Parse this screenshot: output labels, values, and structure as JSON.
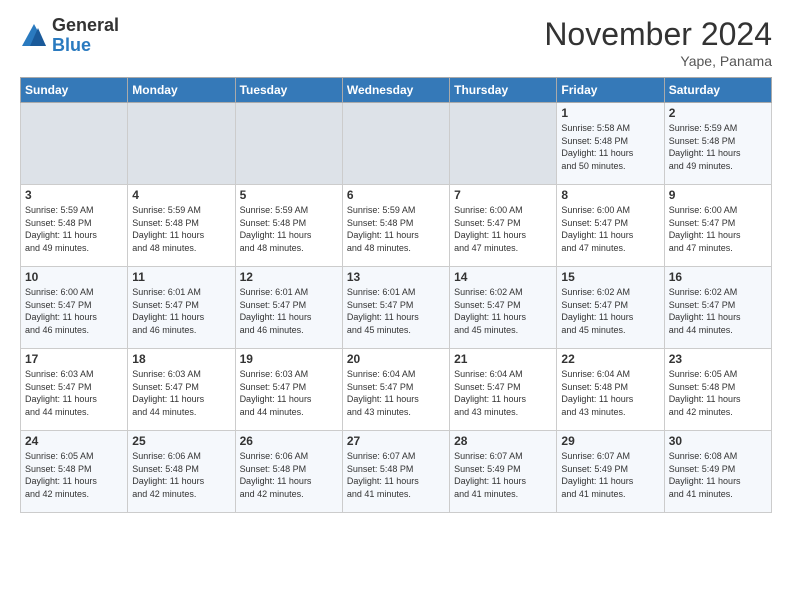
{
  "logo": {
    "general": "General",
    "blue": "Blue"
  },
  "header": {
    "month": "November 2024",
    "location": "Yape, Panama"
  },
  "days_of_week": [
    "Sunday",
    "Monday",
    "Tuesday",
    "Wednesday",
    "Thursday",
    "Friday",
    "Saturday"
  ],
  "weeks": [
    [
      {
        "day": "",
        "info": ""
      },
      {
        "day": "",
        "info": ""
      },
      {
        "day": "",
        "info": ""
      },
      {
        "day": "",
        "info": ""
      },
      {
        "day": "",
        "info": ""
      },
      {
        "day": "1",
        "info": "Sunrise: 5:58 AM\nSunset: 5:48 PM\nDaylight: 11 hours\nand 50 minutes."
      },
      {
        "day": "2",
        "info": "Sunrise: 5:59 AM\nSunset: 5:48 PM\nDaylight: 11 hours\nand 49 minutes."
      }
    ],
    [
      {
        "day": "3",
        "info": "Sunrise: 5:59 AM\nSunset: 5:48 PM\nDaylight: 11 hours\nand 49 minutes."
      },
      {
        "day": "4",
        "info": "Sunrise: 5:59 AM\nSunset: 5:48 PM\nDaylight: 11 hours\nand 48 minutes."
      },
      {
        "day": "5",
        "info": "Sunrise: 5:59 AM\nSunset: 5:48 PM\nDaylight: 11 hours\nand 48 minutes."
      },
      {
        "day": "6",
        "info": "Sunrise: 5:59 AM\nSunset: 5:48 PM\nDaylight: 11 hours\nand 48 minutes."
      },
      {
        "day": "7",
        "info": "Sunrise: 6:00 AM\nSunset: 5:47 PM\nDaylight: 11 hours\nand 47 minutes."
      },
      {
        "day": "8",
        "info": "Sunrise: 6:00 AM\nSunset: 5:47 PM\nDaylight: 11 hours\nand 47 minutes."
      },
      {
        "day": "9",
        "info": "Sunrise: 6:00 AM\nSunset: 5:47 PM\nDaylight: 11 hours\nand 47 minutes."
      }
    ],
    [
      {
        "day": "10",
        "info": "Sunrise: 6:00 AM\nSunset: 5:47 PM\nDaylight: 11 hours\nand 46 minutes."
      },
      {
        "day": "11",
        "info": "Sunrise: 6:01 AM\nSunset: 5:47 PM\nDaylight: 11 hours\nand 46 minutes."
      },
      {
        "day": "12",
        "info": "Sunrise: 6:01 AM\nSunset: 5:47 PM\nDaylight: 11 hours\nand 46 minutes."
      },
      {
        "day": "13",
        "info": "Sunrise: 6:01 AM\nSunset: 5:47 PM\nDaylight: 11 hours\nand 45 minutes."
      },
      {
        "day": "14",
        "info": "Sunrise: 6:02 AM\nSunset: 5:47 PM\nDaylight: 11 hours\nand 45 minutes."
      },
      {
        "day": "15",
        "info": "Sunrise: 6:02 AM\nSunset: 5:47 PM\nDaylight: 11 hours\nand 45 minutes."
      },
      {
        "day": "16",
        "info": "Sunrise: 6:02 AM\nSunset: 5:47 PM\nDaylight: 11 hours\nand 44 minutes."
      }
    ],
    [
      {
        "day": "17",
        "info": "Sunrise: 6:03 AM\nSunset: 5:47 PM\nDaylight: 11 hours\nand 44 minutes."
      },
      {
        "day": "18",
        "info": "Sunrise: 6:03 AM\nSunset: 5:47 PM\nDaylight: 11 hours\nand 44 minutes."
      },
      {
        "day": "19",
        "info": "Sunrise: 6:03 AM\nSunset: 5:47 PM\nDaylight: 11 hours\nand 44 minutes."
      },
      {
        "day": "20",
        "info": "Sunrise: 6:04 AM\nSunset: 5:47 PM\nDaylight: 11 hours\nand 43 minutes."
      },
      {
        "day": "21",
        "info": "Sunrise: 6:04 AM\nSunset: 5:47 PM\nDaylight: 11 hours\nand 43 minutes."
      },
      {
        "day": "22",
        "info": "Sunrise: 6:04 AM\nSunset: 5:48 PM\nDaylight: 11 hours\nand 43 minutes."
      },
      {
        "day": "23",
        "info": "Sunrise: 6:05 AM\nSunset: 5:48 PM\nDaylight: 11 hours\nand 42 minutes."
      }
    ],
    [
      {
        "day": "24",
        "info": "Sunrise: 6:05 AM\nSunset: 5:48 PM\nDaylight: 11 hours\nand 42 minutes."
      },
      {
        "day": "25",
        "info": "Sunrise: 6:06 AM\nSunset: 5:48 PM\nDaylight: 11 hours\nand 42 minutes."
      },
      {
        "day": "26",
        "info": "Sunrise: 6:06 AM\nSunset: 5:48 PM\nDaylight: 11 hours\nand 42 minutes."
      },
      {
        "day": "27",
        "info": "Sunrise: 6:07 AM\nSunset: 5:48 PM\nDaylight: 11 hours\nand 41 minutes."
      },
      {
        "day": "28",
        "info": "Sunrise: 6:07 AM\nSunset: 5:49 PM\nDaylight: 11 hours\nand 41 minutes."
      },
      {
        "day": "29",
        "info": "Sunrise: 6:07 AM\nSunset: 5:49 PM\nDaylight: 11 hours\nand 41 minutes."
      },
      {
        "day": "30",
        "info": "Sunrise: 6:08 AM\nSunset: 5:49 PM\nDaylight: 11 hours\nand 41 minutes."
      }
    ]
  ]
}
